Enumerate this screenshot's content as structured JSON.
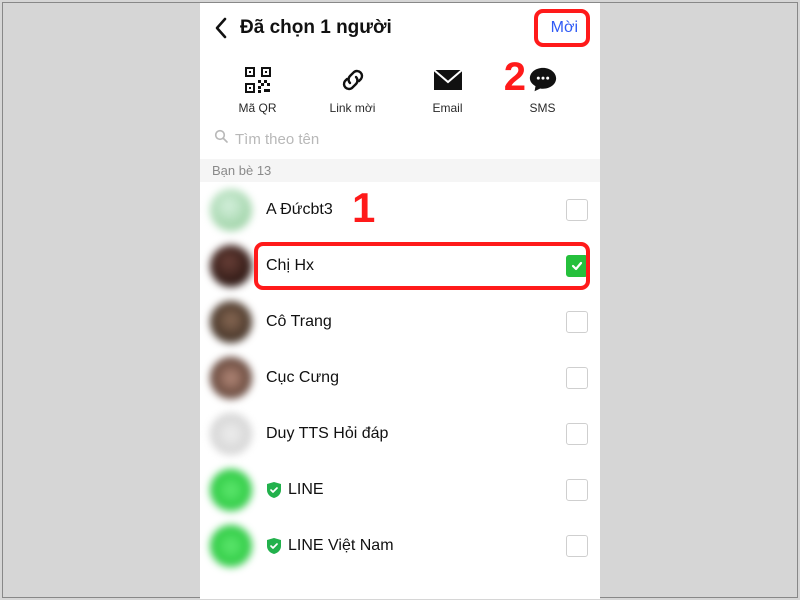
{
  "header": {
    "title": "Đã chọn 1 người",
    "invite_label": "Mời"
  },
  "share": {
    "items": [
      {
        "label": "Mã QR",
        "icon": "qr"
      },
      {
        "label": "Link mời",
        "icon": "link"
      },
      {
        "label": "Email",
        "icon": "mail"
      },
      {
        "label": "SMS",
        "icon": "chat"
      }
    ]
  },
  "search": {
    "placeholder": "Tìm theo tên"
  },
  "section": {
    "friends_label": "Bạn bè 13"
  },
  "annotations": {
    "step1": "1",
    "step2": "2"
  },
  "colors": {
    "highlight": "#ff1a1a",
    "accent": "#25c03c",
    "link": "#2f5af5"
  },
  "friends": [
    {
      "name": "A Đứcbt3",
      "checked": false,
      "verified": false,
      "avatar_class": "av1"
    },
    {
      "name": "Chị Hx",
      "checked": true,
      "verified": false,
      "avatar_class": "av2",
      "highlighted": true
    },
    {
      "name": "Cô Trang",
      "checked": false,
      "verified": false,
      "avatar_class": "av3"
    },
    {
      "name": "Cục Cưng",
      "checked": false,
      "verified": false,
      "avatar_class": "av4"
    },
    {
      "name": "Duy TTS Hỏi đáp",
      "checked": false,
      "verified": false,
      "avatar_class": "av5"
    },
    {
      "name": "LINE",
      "checked": false,
      "verified": true,
      "avatar_class": "av6"
    },
    {
      "name": "LINE Việt Nam",
      "checked": false,
      "verified": true,
      "avatar_class": "av6"
    }
  ]
}
